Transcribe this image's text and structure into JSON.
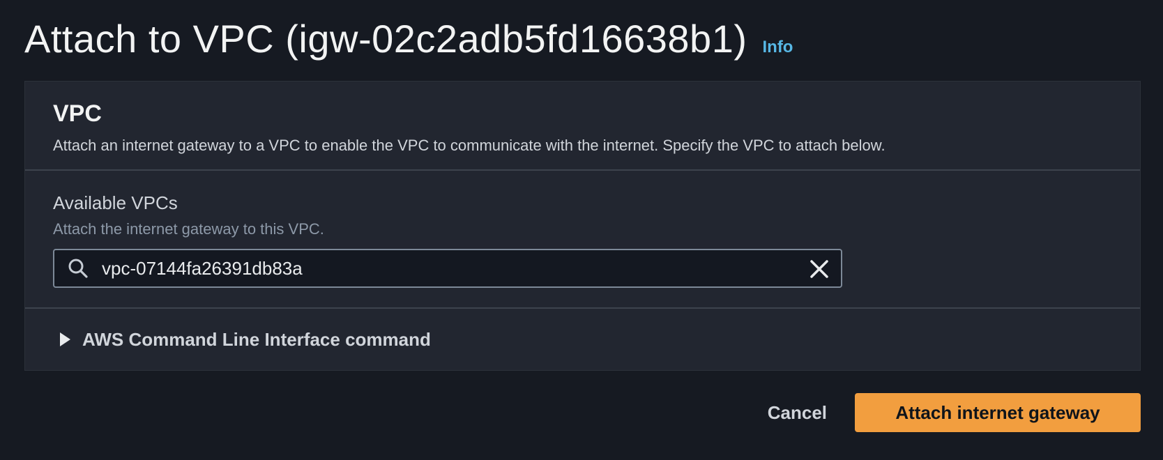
{
  "header": {
    "title": "Attach to VPC (igw-02c2adb5fd16638b1)",
    "info_link": "Info"
  },
  "vpc_panel": {
    "title": "VPC",
    "description": "Attach an internet gateway to a VPC to enable the VPC to communicate with the internet. Specify the VPC to attach below.",
    "field": {
      "label": "Available VPCs",
      "hint": "Attach the internet gateway to this VPC.",
      "value": "vpc-07144fa26391db83a",
      "search_icon": "search-icon",
      "clear_icon": "close-icon"
    },
    "expandable": {
      "label": "AWS Command Line Interface command",
      "icon": "caret-right-icon",
      "expanded": false
    }
  },
  "actions": {
    "cancel_label": "Cancel",
    "primary_label": "Attach internet gateway"
  },
  "colors": {
    "background": "#161a22",
    "panel": "#222630",
    "link": "#57b7e5",
    "primary_button": "#f29e3f"
  }
}
